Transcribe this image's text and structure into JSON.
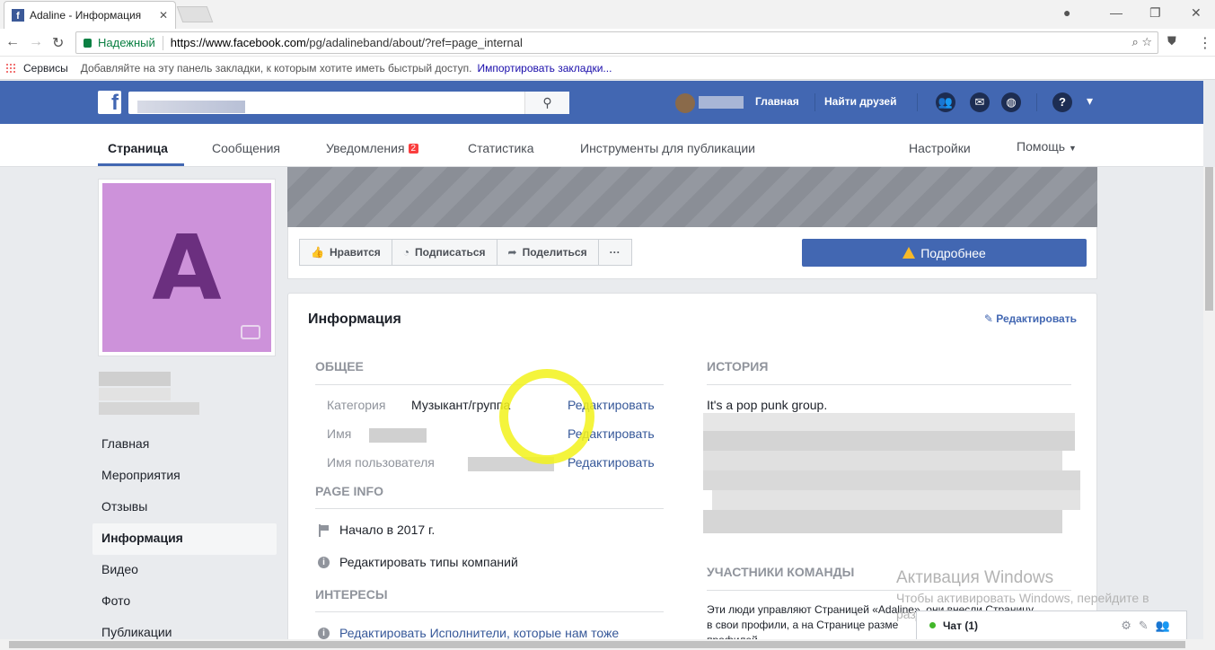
{
  "browser": {
    "tab_title": "Adaline - Информация",
    "tab_close": "✕",
    "secure_label": "Надежный",
    "url_scheme_host": "https://www.facebook.com",
    "url_path": "/pg/adalineband/about/?ref=page_internal",
    "bookmarks_apps": "Сервисы",
    "bookmarks_hint": "Добавляйте на эту панель закладки, к которым хотите иметь быстрый доступ.",
    "bookmarks_import": "Импортировать закладки..."
  },
  "bluebar": {
    "home": "Главная",
    "find_friends": "Найти друзей"
  },
  "page_nav": {
    "page": "Страница",
    "messages": "Сообщения",
    "notifications": "Уведомления",
    "notifications_count": "2",
    "stats": "Статистика",
    "tools": "Инструменты для публикации",
    "settings": "Настройки",
    "help": "Помощь"
  },
  "profile": {
    "letter": "A"
  },
  "left_nav": [
    "Главная",
    "Мероприятия",
    "Отзывы",
    "Информация",
    "Видео",
    "Фото",
    "Публикации"
  ],
  "actions": {
    "like": "Нравится",
    "follow": "Подписаться",
    "share": "Поделиться",
    "more": "···",
    "learn_more": "Подробнее"
  },
  "info": {
    "title": "Информация",
    "edit": "Редактировать",
    "general_header": "ОБЩЕЕ",
    "category_label": "Категория",
    "category_value": "Музыкант/группа",
    "name_label": "Имя",
    "username_label": "Имя пользователя",
    "row_edit": "Редактировать",
    "page_info_header": "PAGE INFO",
    "started": "Начало в 2017 г.",
    "edit_business_types": "Редактировать типы компаний",
    "interests_header": "ИНТЕРЕСЫ",
    "edit_artists": "Редактировать Исполнители, которые нам тоже",
    "history_header": "ИСТОРИЯ",
    "history_text": "It's a pop punk group.",
    "team_header": "УЧАСТНИКИ КОМАНДЫ",
    "team_line1": "Эти люди управляют Страницей «Adaline», они внесли Страницу",
    "team_line2": "в свои профили, а на Странице разме",
    "team_line3": "профилей."
  },
  "watermark": {
    "line1": "Активация Windows",
    "line2": "Чтобы активировать Windows, перейдите в",
    "line3": "раздел \"Параметры\"."
  },
  "chat": {
    "label": "Чат (1)"
  }
}
